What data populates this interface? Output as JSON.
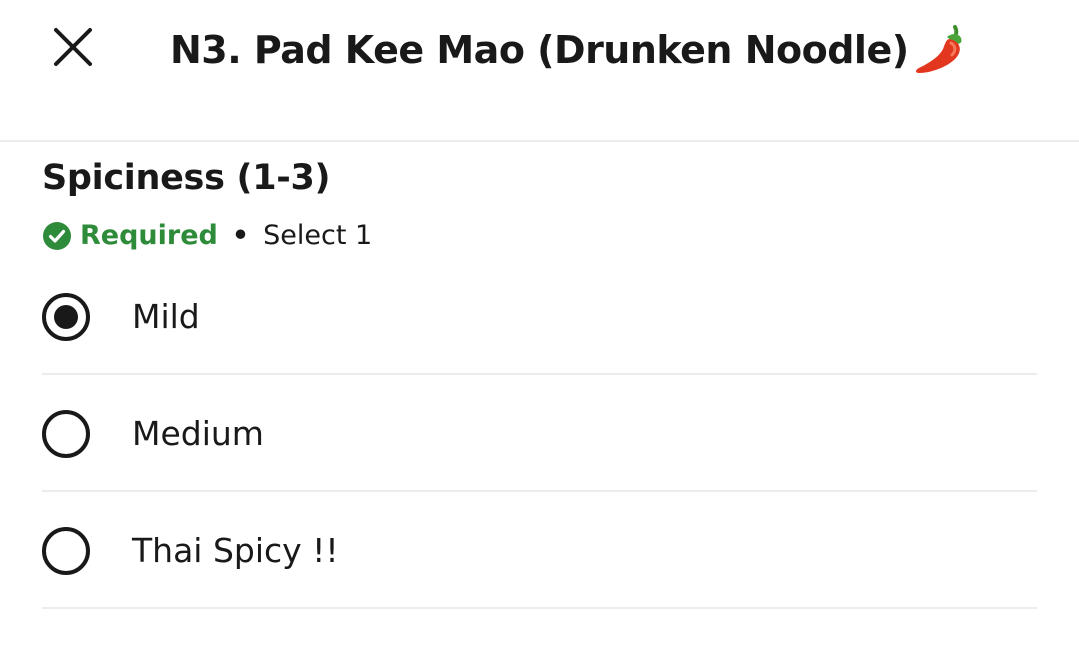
{
  "header": {
    "title": "N3. Pad Kee Mao (Drunken Noodle)",
    "title_emoji_icon": "chili-pepper-icon",
    "close_icon": "close-icon"
  },
  "section": {
    "title": "Spiciness (1-3)",
    "required_label": "Required",
    "separator": "•",
    "select_label": "Select 1",
    "required_color": "#2e8b3a"
  },
  "options": [
    {
      "label": "Mild",
      "selected": true
    },
    {
      "label": "Medium",
      "selected": false
    },
    {
      "label": "Thai Spicy !!",
      "selected": false
    }
  ]
}
